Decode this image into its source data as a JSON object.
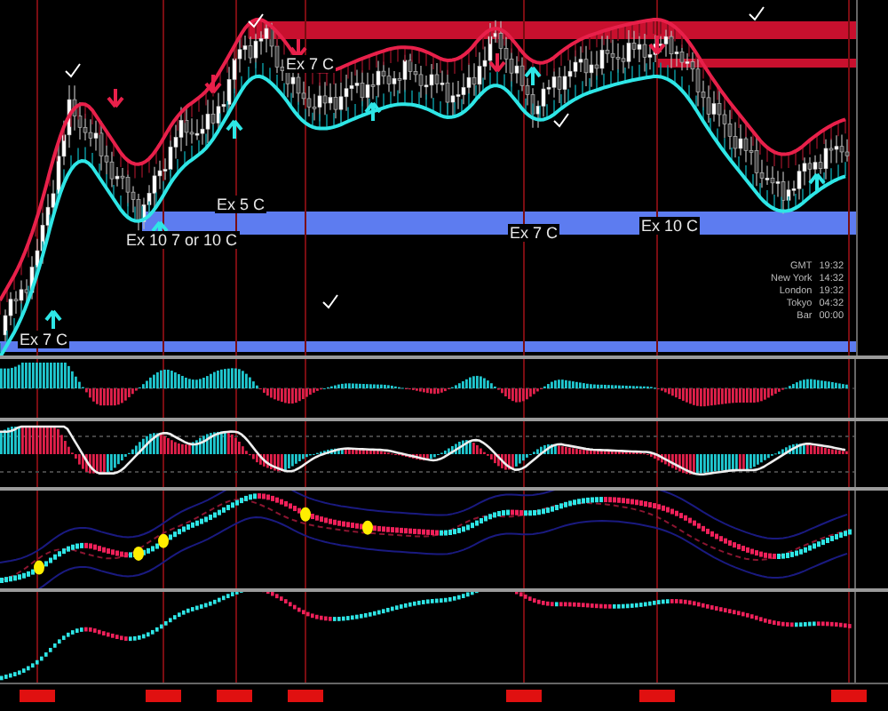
{
  "annotations": [
    {
      "text": "Ex 7 C"
    },
    {
      "text": "Ex 10 7 or 10 C"
    },
    {
      "text": "Ex 5 C"
    },
    {
      "text": "Ex 7 C"
    },
    {
      "text": "Ex 10 C"
    },
    {
      "text": "Ex 7 C"
    }
  ],
  "session_clock": [
    {
      "label": "GMT",
      "value": "19:32"
    },
    {
      "label": "New York",
      "value": "14:32"
    },
    {
      "label": "London",
      "value": "19:32"
    },
    {
      "label": "Tokyo",
      "value": "04:32"
    },
    {
      "label": "Bar",
      "value": "00:00"
    }
  ]
}
